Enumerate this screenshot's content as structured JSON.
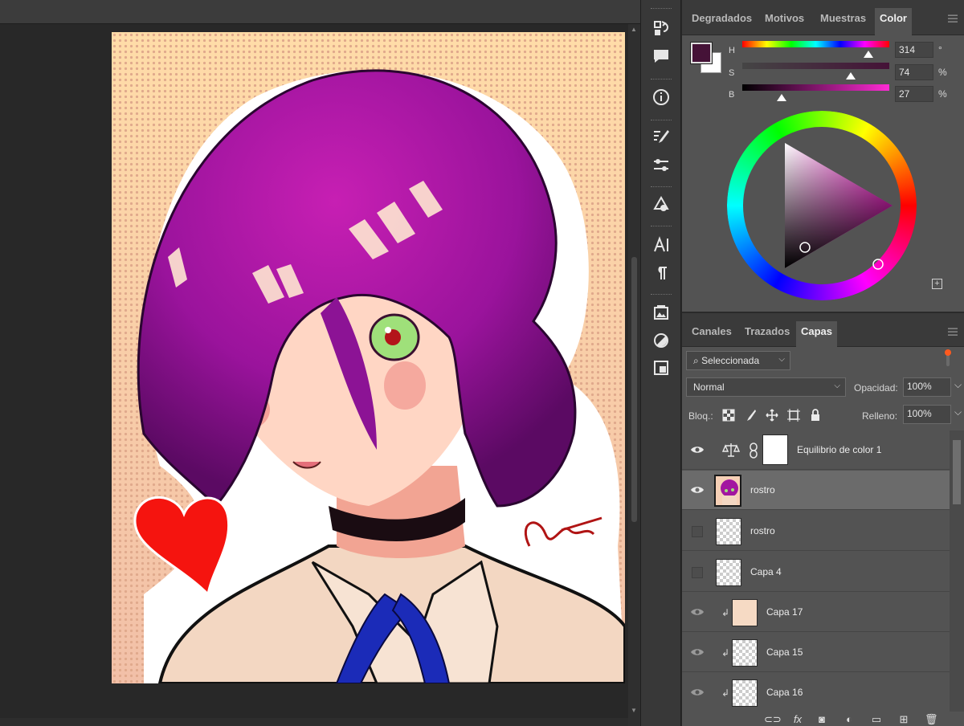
{
  "color_panel": {
    "tabs": [
      "Degradados",
      "Motivos",
      "Muestras",
      "Color"
    ],
    "active_tab": "Color",
    "hsb": [
      {
        "label": "H",
        "value": "314",
        "unit": "°",
        "fraction": 0.86
      },
      {
        "label": "S",
        "value": "74",
        "unit": "%",
        "fraction": 0.74
      },
      {
        "label": "B",
        "value": "27",
        "unit": "%",
        "fraction": 0.27
      }
    ],
    "foreground_color": "#451237",
    "background_color": "#ffffff",
    "hue_color": "#ff2bd5"
  },
  "layers_panel": {
    "tabs": [
      "Canales",
      "Trazados",
      "Capas"
    ],
    "active_tab": "Capas",
    "filter_value": "Seleccionada",
    "blend_mode": "Normal",
    "opacity_label": "Opacidad:",
    "opacity_value": "100%",
    "lock_label": "Bloq.:",
    "fill_label": "Relleno:",
    "fill_value": "100%",
    "layers": [
      {
        "name": "Equilibrio de color 1",
        "visible": true,
        "selected": false,
        "type": "adjustment"
      },
      {
        "name": "rostro",
        "visible": true,
        "selected": true,
        "type": "art"
      },
      {
        "name": "rostro",
        "visible": false,
        "selected": false,
        "type": "transparent"
      },
      {
        "name": "Capa 4",
        "visible": false,
        "selected": false,
        "type": "transparent"
      },
      {
        "name": "Capa 17",
        "visible": true,
        "selected": false,
        "type": "clipped"
      },
      {
        "name": "Capa 15",
        "visible": true,
        "selected": false,
        "type": "clipped"
      },
      {
        "name": "Capa 16",
        "visible": true,
        "selected": false,
        "type": "clipped"
      }
    ]
  },
  "tools": [
    "history-icon",
    "comments-icon",
    "info-icon",
    "brush-settings-icon",
    "adjust-icon",
    "shapes-icon",
    "character-icon",
    "paragraph-icon",
    "library-icon",
    "adjustments-circle-icon",
    "properties-icon"
  ]
}
